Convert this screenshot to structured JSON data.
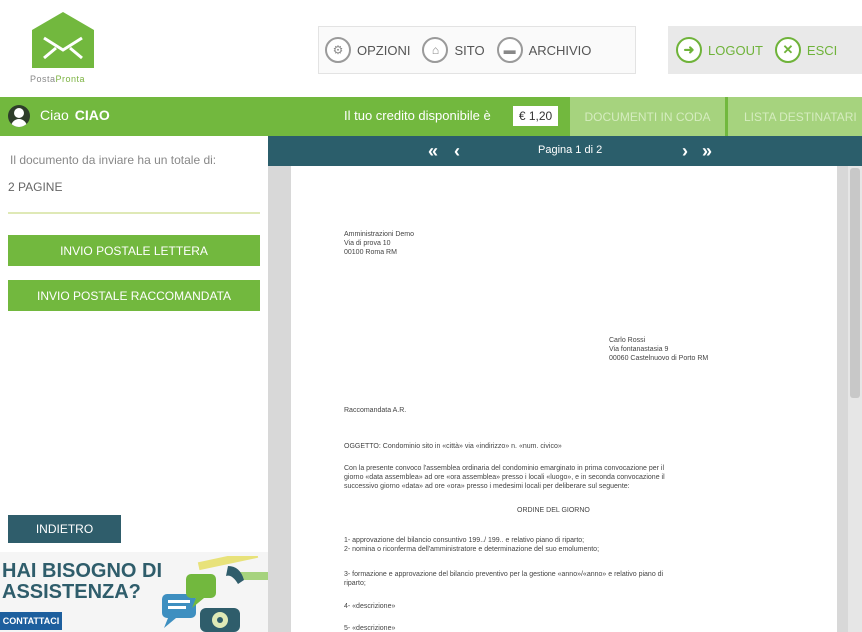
{
  "logo": {
    "text_a": "Posta",
    "text_b": "Pronta"
  },
  "nav": {
    "options": "OPZIONI",
    "site": "SITO",
    "archive": "ARCHIVIO",
    "logout": "LOGOUT",
    "exit": "ESCI"
  },
  "greenbar": {
    "greeting": "Ciao",
    "username": "CIAO",
    "credit_label": "Il tuo credito disponibile è",
    "credit_value": "€ 1,20",
    "tab_docs": "DOCUMENTI IN CODA",
    "tab_list": "LISTA DESTINATARI"
  },
  "left": {
    "info": "Il documento da inviare ha un totale di:",
    "pages": "2 PAGINE",
    "btn_letter": "INVIO POSTALE LETTERA",
    "btn_registered": "INVIO POSTALE RACCOMANDATA",
    "btn_back": "INDIETRO"
  },
  "help": {
    "line1": "HAI BISOGNO DI",
    "line2": "ASSISTENZA?",
    "contact": "CONTATTACI"
  },
  "viewer": {
    "first": "«",
    "prev": "‹",
    "page_indicator": "Pagina 1 di 2",
    "next": "›",
    "last": "»"
  },
  "document": {
    "sender": [
      "Amministrazioni Demo",
      "Via di prova 10",
      "00100 Roma RM"
    ],
    "recipient": [
      "Carlo Rossi",
      "Via fontanastasia 9",
      "00060 Castelnuovo di Porto RM"
    ],
    "mode": "Raccomandata A.R.",
    "subject": "OGGETTO: Condominio sito in «città» via «indirizzo» n. «num. civico»",
    "body": [
      "Con la presente convoco l'assemblea ordinaria del condominio emarginato in prima convocazione per il",
      "giorno «data assemblea» ad ore «ora assemblea» presso i locali «luogo», e in seconda convocazione il",
      "successivo giorno «data» ad ore «ora» presso i medesimi locali per deliberare sul seguente:"
    ],
    "agenda_title": "ORDINE DEL GIORNO",
    "items": [
      "1- approvazione del bilancio consuntivo 199../ 199.. e relativo piano di riparto;",
      "2- nomina o riconferma dell'amministratore e determinazione del suo emolumento;",
      "3- formazione e approvazione del bilancio preventivo per la gestione «anno»/«anno» e relativo piano di",
      "riparto;",
      "4- «descrizione»",
      "5- «descrizione»"
    ]
  },
  "colors": {
    "green": "#72b83e",
    "teal": "#2b5e6b",
    "light_green": "#a6d37e"
  }
}
